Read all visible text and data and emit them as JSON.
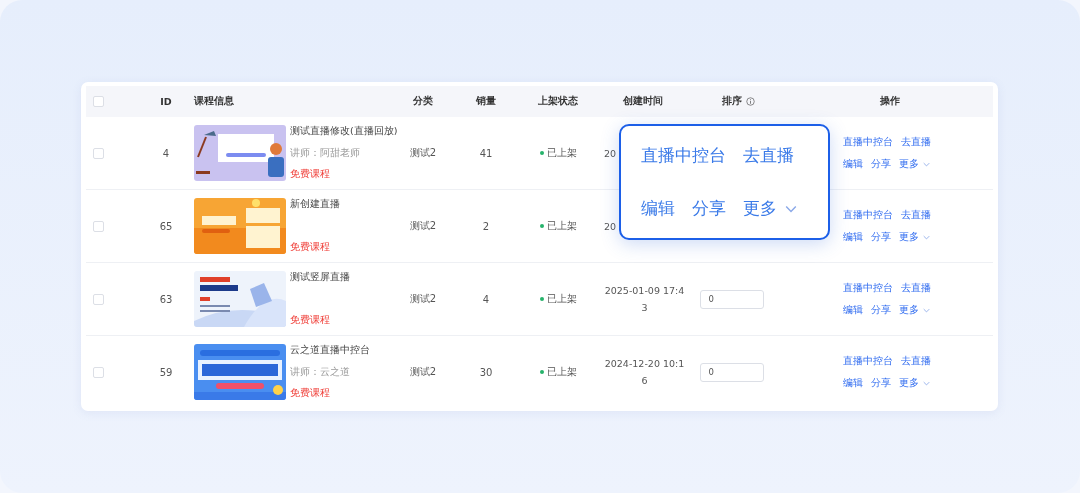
{
  "table": {
    "select_all": {
      "checked": false
    },
    "columns": [
      "ID",
      "课程信息",
      "分类",
      "销量",
      "上架状态",
      "创建时间",
      "排序",
      "操作"
    ],
    "rows": [
      {
        "checked": false,
        "id": "4",
        "title": "测试直播修改(直播回放)",
        "teacher": "讲师：阿甜老师",
        "price": "免费课程",
        "category": "测试2",
        "sales": "41",
        "status": "已上架",
        "on_shelf": true,
        "created": "20",
        "actions": [
          "直播中控台",
          "去直播",
          "编辑",
          "分享",
          "更多"
        ]
      },
      {
        "checked": false,
        "id": "65",
        "title": "新创建直播",
        "price": "免费课程",
        "category": "测试2",
        "sales": "2",
        "status": "已上架",
        "on_shelf": true,
        "created": "20",
        "actions": [
          "直播中控台",
          "去直播",
          "编辑",
          "分享",
          "更多"
        ]
      },
      {
        "checked": false,
        "id": "63",
        "title": "测试竖屏直播",
        "price": "免费课程",
        "category": "测试2",
        "sales": "4",
        "status": "已上架",
        "on_shelf": true,
        "created": "2025-01-09 17:43",
        "sort": "0",
        "actions": [
          "直播中控台",
          "去直播",
          "编辑",
          "分享",
          "更多"
        ]
      },
      {
        "checked": false,
        "id": "59",
        "title": "云之道直播中控台",
        "teacher": "讲师：云之道",
        "price": "免费课程",
        "category": "测试2",
        "sales": "30",
        "status": "已上架",
        "on_shelf": true,
        "created": "2024-12-20 10:16",
        "sort": "0",
        "actions": [
          "直播中控台",
          "去直播",
          "编辑",
          "分享",
          "更多"
        ]
      }
    ]
  },
  "callout": {
    "actions": [
      "直播中控台",
      "去直播",
      "编辑",
      "分享",
      "更多"
    ]
  }
}
